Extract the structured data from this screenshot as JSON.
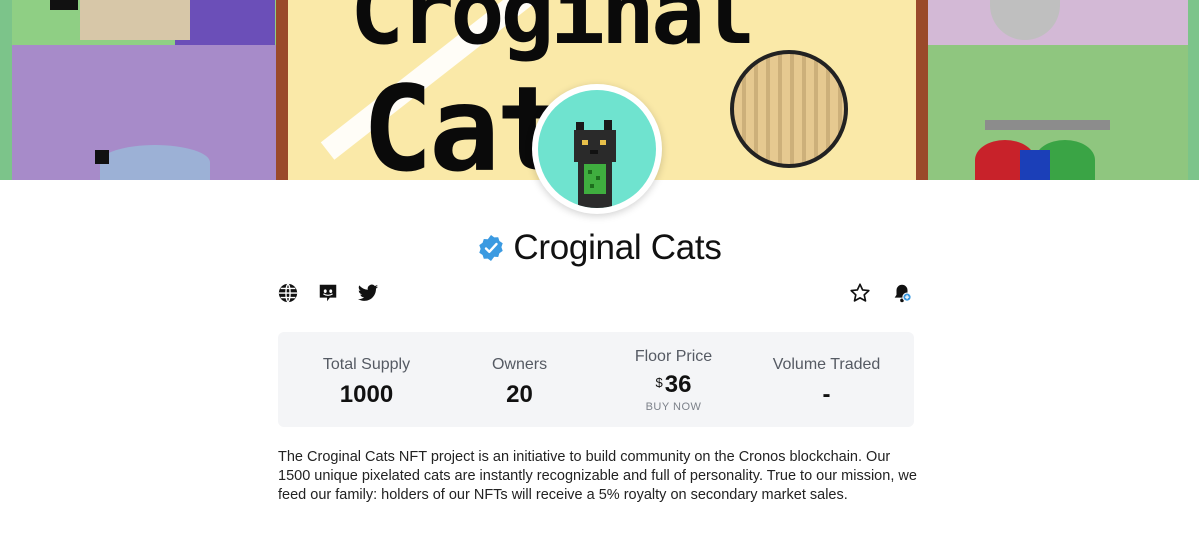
{
  "collection": {
    "name": "Croginal Cats",
    "description": "The Croginal Cats NFT project is an initiative to build community on the Cronos blockchain. Our 1500 unique pixelated cats are instantly recognizable and full of personality. True to our mission, we feed our family: holders of our NFTs will receive a 5% royalty on secondary market sales."
  },
  "banner": {
    "art_line1": "Croginal",
    "art_line2": "Cats"
  },
  "social": {
    "links": [
      "globe-icon",
      "discord-icon",
      "twitter-icon"
    ]
  },
  "actions": {
    "icons": [
      "star-icon",
      "bell-icon"
    ]
  },
  "stats": {
    "total_supply": {
      "label": "Total Supply",
      "value": "1000"
    },
    "owners": {
      "label": "Owners",
      "value": "20"
    },
    "floor_price": {
      "label": "Floor Price",
      "currency": "$",
      "value": "36",
      "cta": "BUY NOW"
    },
    "volume_traded": {
      "label": "Volume Traded",
      "value": "-"
    }
  },
  "colors": {
    "avatar_bg": "#6fe3cf",
    "verified": "#3b9ae1",
    "stats_bg": "#f4f5f7",
    "banner_bg": "#fae9a8"
  }
}
